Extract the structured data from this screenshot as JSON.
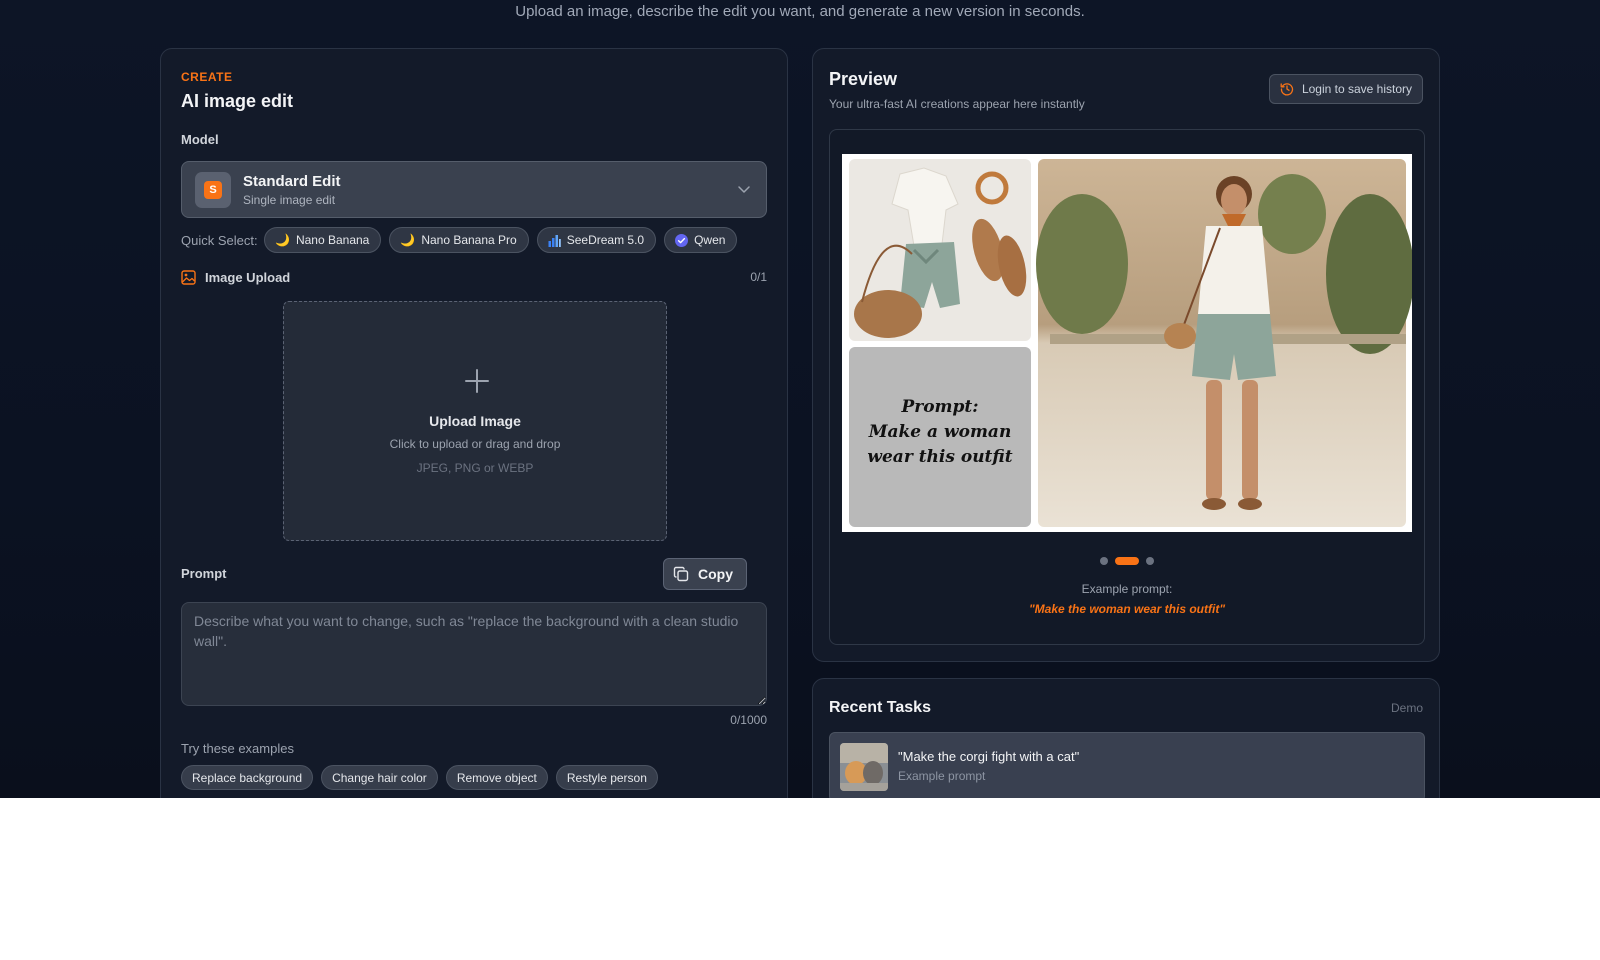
{
  "header": {
    "subtitle": "Upload an image, describe the edit you want, and generate a new version in seconds."
  },
  "create": {
    "eyebrow": "CREATE",
    "title": "AI image edit",
    "model_label": "Model",
    "model": {
      "badge": "S",
      "name": "Standard Edit",
      "description": "Single image edit"
    },
    "quick_select_label": "Quick Select:",
    "quick_select": [
      {
        "label": "Nano Banana",
        "icon": "moon-icon"
      },
      {
        "label": "Nano Banana Pro",
        "icon": "moon-icon"
      },
      {
        "label": "SeeDream 5.0",
        "icon": "bar-chart-icon"
      },
      {
        "label": "Qwen",
        "icon": "check-circle-icon"
      }
    ],
    "image_upload_label": "Image Upload",
    "image_upload_count": "0/1",
    "upload": {
      "title": "Upload Image",
      "subtitle": "Click to upload or drag and drop",
      "types": "JPEG, PNG or WEBP"
    },
    "prompt_label": "Prompt",
    "copy_label": "Copy",
    "prompt_value": "",
    "prompt_placeholder": "Describe what you want to change, such as \"replace the background with a clean studio wall\".",
    "prompt_counter": "0/1000",
    "examples_label": "Try these examples",
    "examples": [
      "Replace background",
      "Change hair color",
      "Remove object",
      "Restyle person"
    ]
  },
  "preview": {
    "title": "Preview",
    "subtitle": "Your ultra-fast AI creations appear here instantly",
    "login_label": "Login to save history",
    "image_caption_lines": [
      "Prompt:",
      "Make a woman",
      "wear this outfit"
    ],
    "slides": 3,
    "active_slide": 2,
    "example_prompt_label": "Example prompt:",
    "example_prompt": "\"Make the woman wear this outfit\""
  },
  "tasks": {
    "title": "Recent Tasks",
    "badge": "Demo",
    "items": [
      {
        "title": "\"Make the corgi fight with a cat\"",
        "subtitle": "Example prompt"
      }
    ]
  },
  "colors": {
    "accent": "#f97316",
    "background": "#0b1222",
    "card": "#131a29"
  }
}
